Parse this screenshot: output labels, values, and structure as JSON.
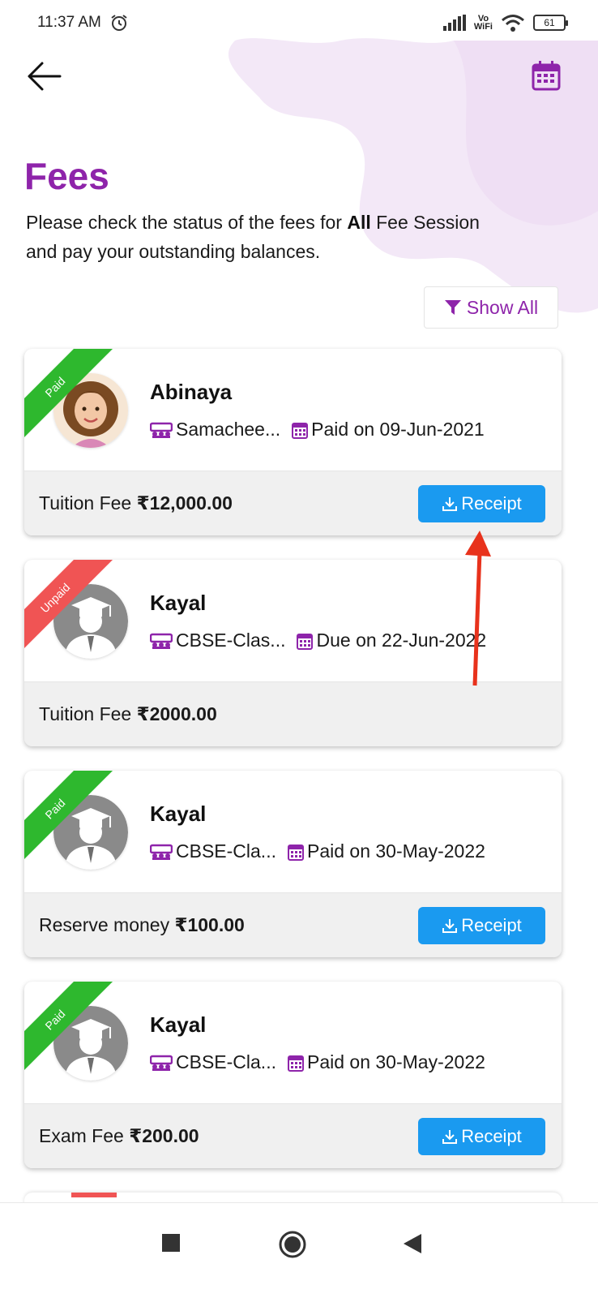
{
  "status_bar": {
    "time": "11:37 AM",
    "vo_line1": "Vo",
    "vo_line2": "WiFi",
    "battery": "61"
  },
  "header": {
    "title": "Fees",
    "description_before": "Please check the status of the fees for ",
    "description_bold": "All",
    "description_after": " Fee Session and pay your outstanding balances.",
    "filter_label": "Show All"
  },
  "colors": {
    "brand": "#8e24aa",
    "paid": "#2eb82e",
    "unpaid": "#f05454",
    "receipt": "#1a9af0",
    "annotation": "#e8321c"
  },
  "fees": [
    {
      "status": "Paid",
      "name": "Abinaya",
      "class": "Samachee...",
      "date_text": "Paid on 09-Jun-2021",
      "fee_label": "Tuition Fee",
      "amount": "₹12,000.00",
      "receipt_label": "Receipt",
      "avatar": "girl-photo"
    },
    {
      "status": "Unpaid",
      "name": "Kayal",
      "class": "CBSE-Clas...",
      "date_text": "Due on 22-Jun-2022",
      "fee_label": "Tuition Fee",
      "amount": "₹2000.00",
      "avatar": "graduate-placeholder"
    },
    {
      "status": "Paid",
      "name": "Kayal",
      "class": "CBSE-Cla...",
      "date_text": "Paid on 30-May-2022",
      "fee_label": "Reserve money",
      "amount": "₹100.00",
      "receipt_label": "Receipt",
      "avatar": "graduate-placeholder"
    },
    {
      "status": "Paid",
      "name": "Kayal",
      "class": "CBSE-Cla...",
      "date_text": "Paid on 30-May-2022",
      "fee_label": "Exam Fee",
      "amount": "₹200.00",
      "receipt_label": "Receipt",
      "avatar": "graduate-placeholder"
    }
  ]
}
